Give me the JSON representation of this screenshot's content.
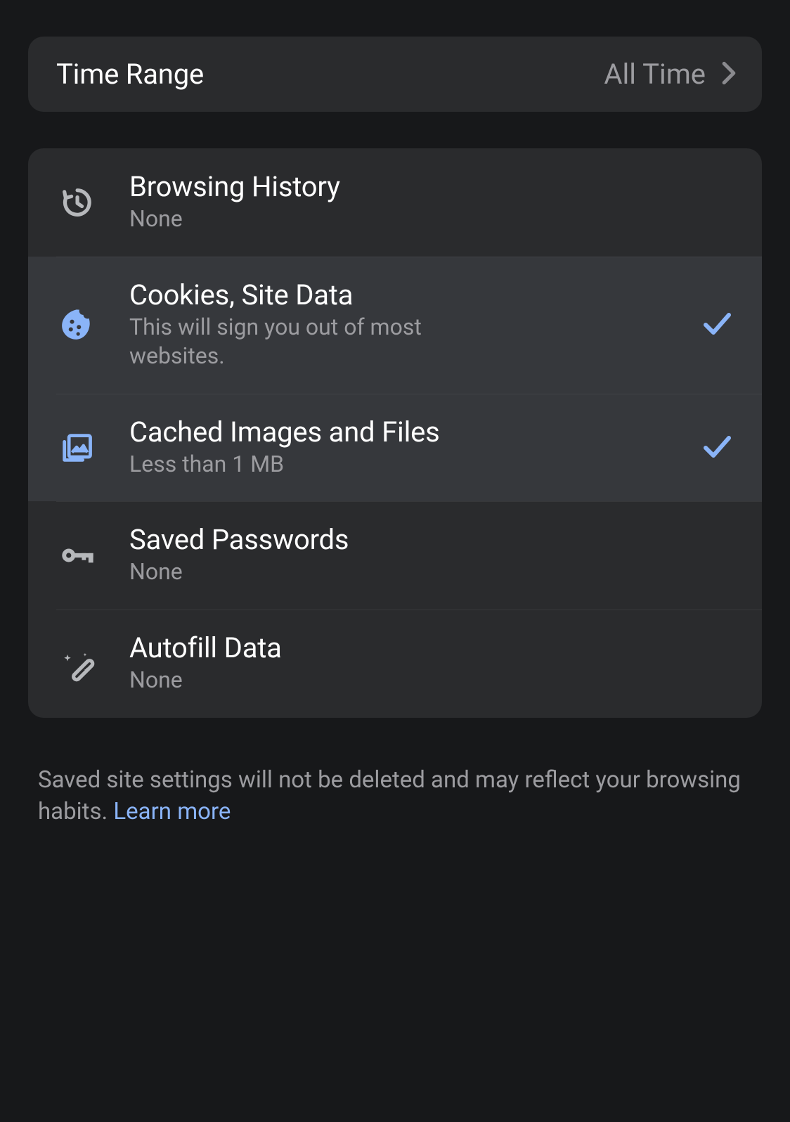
{
  "colors": {
    "accent": "#8ab4f8",
    "text_secondary": "#9c9ca0",
    "icon_default": "#b6b8bb"
  },
  "time_range": {
    "label": "Time Range",
    "value": "All Time"
  },
  "options": {
    "browsing_history": {
      "title": "Browsing History",
      "subtitle": "None",
      "selected": false
    },
    "cookies": {
      "title": "Cookies, Site Data",
      "subtitle": "This will sign you out of most websites.",
      "selected": true
    },
    "cache": {
      "title": "Cached Images and Files",
      "subtitle": "Less than 1 MB",
      "selected": true
    },
    "passwords": {
      "title": "Saved Passwords",
      "subtitle": "None",
      "selected": false
    },
    "autofill": {
      "title": "Autofill Data",
      "subtitle": "None",
      "selected": false
    }
  },
  "footer": {
    "text": "Saved site settings will not be deleted and may reflect your browsing habits. ",
    "link": "Learn more"
  }
}
